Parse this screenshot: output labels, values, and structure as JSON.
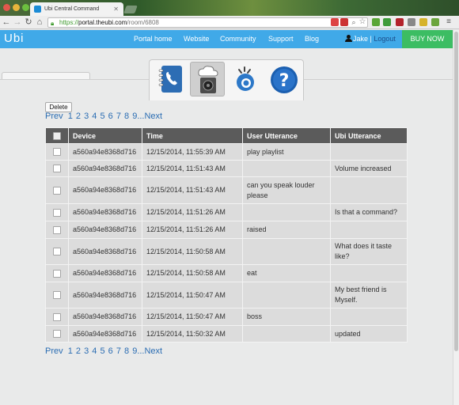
{
  "browser": {
    "tab_title": "Ubi Central Command",
    "url_scheme": "https://",
    "url_host": "portal.theubi.com",
    "url_path": "/room/6808"
  },
  "navbar": {
    "brand": "Ubi",
    "links": [
      "Portal home",
      "Website",
      "Community",
      "Support",
      "Blog"
    ],
    "user": "Jake",
    "separator": "|",
    "logout": "Logout",
    "buy_now": "BUY NOW",
    "colors": {
      "bar": "#40a9e8",
      "buy": "#3cbd63"
    }
  },
  "tabs": {
    "icons": [
      "phonebook-icon",
      "speaker-cloud-icon",
      "microphone-signal-icon",
      "help-icon"
    ]
  },
  "controls": {
    "delete_label": "Delete"
  },
  "pager": {
    "prev": "Prev",
    "pages": [
      "1",
      "2",
      "3",
      "4",
      "5",
      "6",
      "7",
      "8",
      "9"
    ],
    "ellipsis": "...",
    "next": "Next"
  },
  "table": {
    "columns": [
      "Device",
      "Time",
      "User Utterance",
      "Ubi Utterance"
    ],
    "rows": [
      {
        "device": "a560a94e8368d716",
        "time": "12/15/2014, 11:55:39 AM",
        "user": "play playlist",
        "ubi": ""
      },
      {
        "device": "a560a94e8368d716",
        "time": "12/15/2014, 11:51:43 AM",
        "user": "",
        "ubi": "Volume increased"
      },
      {
        "device": "a560a94e8368d716",
        "time": "12/15/2014, 11:51:43 AM",
        "user": "can you speak louder please",
        "ubi": ""
      },
      {
        "device": "a560a94e8368d716",
        "time": "12/15/2014, 11:51:26 AM",
        "user": "",
        "ubi": "Is that a command?"
      },
      {
        "device": "a560a94e8368d716",
        "time": "12/15/2014, 11:51:26 AM",
        "user": "raised",
        "ubi": ""
      },
      {
        "device": "a560a94e8368d716",
        "time": "12/15/2014, 11:50:58 AM",
        "user": "",
        "ubi": "What does it taste like?"
      },
      {
        "device": "a560a94e8368d716",
        "time": "12/15/2014, 11:50:58 AM",
        "user": "eat",
        "ubi": ""
      },
      {
        "device": "a560a94e8368d716",
        "time": "12/15/2014, 11:50:47 AM",
        "user": "",
        "ubi": "My best friend is Myself."
      },
      {
        "device": "a560a94e8368d716",
        "time": "12/15/2014, 11:50:47 AM",
        "user": "boss",
        "ubi": ""
      },
      {
        "device": "a560a94e8368d716",
        "time": "12/15/2014, 11:50:32 AM",
        "user": "",
        "ubi": "updated"
      }
    ]
  }
}
